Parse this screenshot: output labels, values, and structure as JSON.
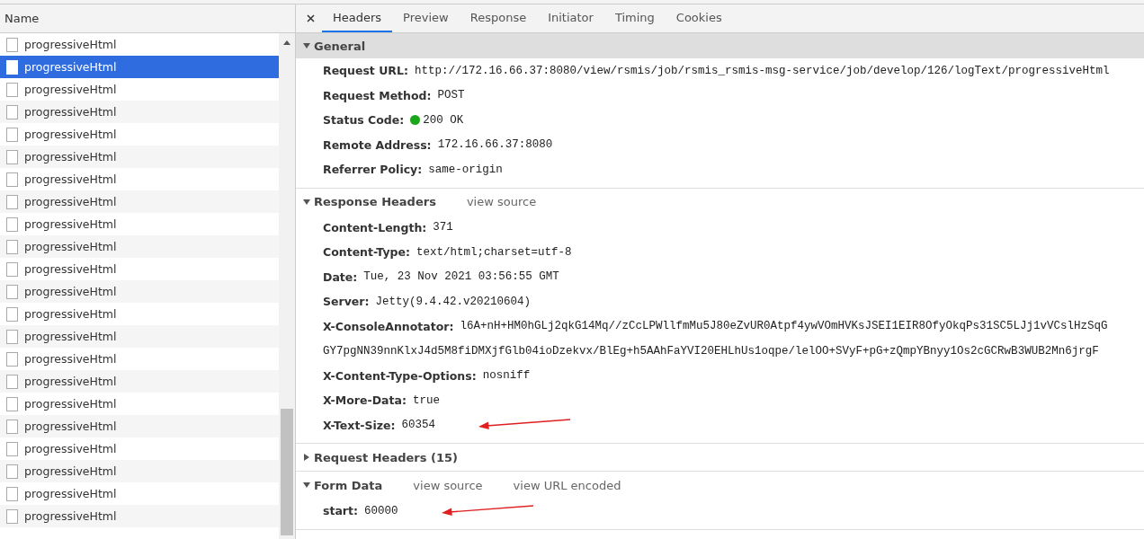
{
  "requests": {
    "column": "Name",
    "rows": [
      {
        "name": "progressiveHtml",
        "selected": false
      },
      {
        "name": "progressiveHtml",
        "selected": true
      },
      {
        "name": "progressiveHtml",
        "selected": false
      },
      {
        "name": "progressiveHtml",
        "selected": false
      },
      {
        "name": "progressiveHtml",
        "selected": false
      },
      {
        "name": "progressiveHtml",
        "selected": false
      },
      {
        "name": "progressiveHtml",
        "selected": false
      },
      {
        "name": "progressiveHtml",
        "selected": false
      },
      {
        "name": "progressiveHtml",
        "selected": false
      },
      {
        "name": "progressiveHtml",
        "selected": false
      },
      {
        "name": "progressiveHtml",
        "selected": false
      },
      {
        "name": "progressiveHtml",
        "selected": false
      },
      {
        "name": "progressiveHtml",
        "selected": false
      },
      {
        "name": "progressiveHtml",
        "selected": false
      },
      {
        "name": "progressiveHtml",
        "selected": false
      },
      {
        "name": "progressiveHtml",
        "selected": false
      },
      {
        "name": "progressiveHtml",
        "selected": false
      },
      {
        "name": "progressiveHtml",
        "selected": false
      },
      {
        "name": "progressiveHtml",
        "selected": false
      },
      {
        "name": "progressiveHtml",
        "selected": false
      },
      {
        "name": "progressiveHtml",
        "selected": false
      },
      {
        "name": "progressiveHtml",
        "selected": false
      }
    ]
  },
  "tabs": [
    {
      "label": "Headers",
      "selected": true
    },
    {
      "label": "Preview",
      "selected": false
    },
    {
      "label": "Response",
      "selected": false
    },
    {
      "label": "Initiator",
      "selected": false
    },
    {
      "label": "Timing",
      "selected": false
    },
    {
      "label": "Cookies",
      "selected": false
    }
  ],
  "sections": [
    {
      "title": "General",
      "expanded": true,
      "fields": [
        {
          "key": "Request URL:",
          "value": "http://172.16.66.37:8080/view/rsmis/job/rsmis_rsmis-msg-service/job/develop/126/logText/progressiveHtml"
        },
        {
          "key": "Request Method:",
          "value": "POST"
        },
        {
          "key": "Status Code:",
          "value": "200 OK",
          "color": "#1aa81a"
        },
        {
          "key": "Remote Address:",
          "value": "172.16.66.37:8080"
        },
        {
          "key": "Referrer Policy:",
          "value": "same-origin"
        }
      ]
    },
    {
      "title": "Response Headers",
      "expanded": true,
      "links": [
        "view source"
      ],
      "fields": [
        {
          "key": "Content-Length:",
          "value": "371"
        },
        {
          "key": "Content-Type:",
          "value": "text/html;charset=utf-8"
        },
        {
          "key": "Date:",
          "value": "Tue, 23 Nov 2021 03:56:55 GMT"
        },
        {
          "key": "Server:",
          "value": "Jetty(9.4.42.v20210604)"
        },
        {
          "key": "X-ConsoleAnnotator:",
          "value": "l6A+nH+HM0hGLj2qkG14Mq//zCcLPWllfmMu5J80eZvUR0Atpf4ywVOmHVKsJSEI1EIR8OfyOkqPs31SC5LJj1vVCslHzSqG",
          "continuation": "GY7pgNN39nnKlxJ4d5M8fiDMXjfGlb04ioDzekvx/BlEg+h5AAhFaYVI20EHLhUs1oqpe/lelOO+SVyF+pG+zQmpYBnyy1Os2cGCRwB3WUB2Mn6jrgF"
        },
        {
          "key": "X-Content-Type-Options:",
          "value": "nosniff"
        },
        {
          "key": "X-More-Data:",
          "value": "true"
        },
        {
          "key": "X-Text-Size:",
          "value": "60354",
          "annotated": true
        }
      ]
    },
    {
      "title": "Request Headers (15)",
      "expanded": false
    },
    {
      "title": "Form Data",
      "expanded": true,
      "links": [
        "view source",
        "view URL encoded"
      ],
      "fields": [
        {
          "key": "start:",
          "value": "60000",
          "annotated": true
        }
      ]
    }
  ]
}
